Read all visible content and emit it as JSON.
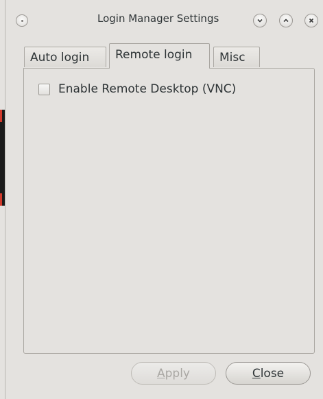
{
  "window": {
    "title": "Login Manager Settings"
  },
  "titlebar": {
    "menu_icon": "window-menu-icon",
    "minimize_icon": "chevron-down-icon",
    "maximize_icon": "chevron-up-icon",
    "close_icon": "close-icon"
  },
  "tabs": [
    {
      "label": "Auto login",
      "active": false
    },
    {
      "label": "Remote login",
      "active": true
    },
    {
      "label": "Misc",
      "active": false
    }
  ],
  "remote_login": {
    "enable_vnc_label": "Enable Remote Desktop (VNC)",
    "enable_vnc_checked": false
  },
  "buttons": {
    "apply": {
      "mnemonic": "A",
      "rest": "pply",
      "enabled": false
    },
    "close": {
      "mnemonic": "C",
      "rest": "lose",
      "enabled": true
    }
  },
  "colors": {
    "window_bg": "#e4e2df",
    "text": "#2e3436",
    "disabled_text": "#a9a7a3"
  }
}
